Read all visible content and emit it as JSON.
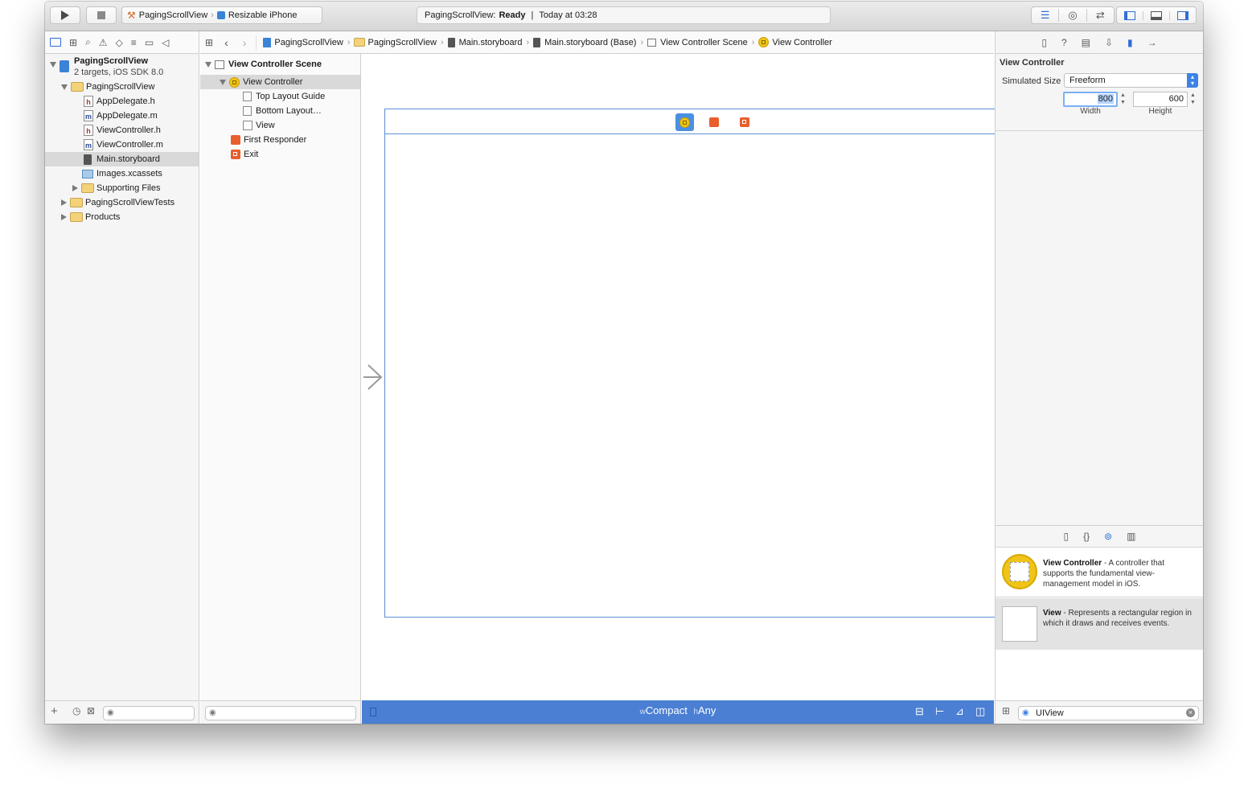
{
  "toolbar": {
    "scheme_name": "PagingScrollView",
    "destination": "Resizable iPhone",
    "activity_project": "PagingScrollView:",
    "activity_status": "Ready",
    "activity_separator": "|",
    "activity_time": "Today at 03:28"
  },
  "breadcrumb": {
    "items": [
      "PagingScrollView",
      "PagingScrollView",
      "Main.storyboard",
      "Main.storyboard (Base)",
      "View Controller Scene",
      "View Controller"
    ]
  },
  "navigator": {
    "project_name": "PagingScrollView",
    "project_subtitle": "2 targets, iOS SDK 8.0",
    "group_name": "PagingScrollView",
    "files": [
      {
        "name": "AppDelegate.h",
        "badge": "h"
      },
      {
        "name": "AppDelegate.m",
        "badge": "m"
      },
      {
        "name": "ViewController.h",
        "badge": "h"
      },
      {
        "name": "ViewController.m",
        "badge": "m"
      },
      {
        "name": "Main.storyboard",
        "badge": ""
      },
      {
        "name": "Images.xcassets",
        "badge": ""
      }
    ],
    "supporting_files": "Supporting Files",
    "tests_group": "PagingScrollViewTests",
    "products_group": "Products"
  },
  "outline": {
    "scene_title": "View Controller Scene",
    "view_controller": "View Controller",
    "top_layout_guide": "Top Layout Guide",
    "bottom_layout": "Bottom Layout…",
    "view": "View",
    "first_responder": "First Responder",
    "exit": "Exit"
  },
  "canvas": {
    "size_class_w_prefix": "w",
    "size_class_w": "Compact",
    "size_class_h_prefix": "h",
    "size_class_h": "Any",
    "accent": "#4a7fd4"
  },
  "inspector": {
    "section_title": "View Controller",
    "simulated_size_label": "Simulated Size",
    "simulated_size_value": "Freeform",
    "width_value": "800",
    "width_label": "Width",
    "height_value": "600",
    "height_label": "Height"
  },
  "library": {
    "items": [
      {
        "title": "View Controller",
        "desc": " - A controller that supports the fundamental view-management model in iOS."
      },
      {
        "title": "View",
        "desc": " - Represents a rectangular region in which it draws and receives events."
      }
    ],
    "search_value": "UIView"
  }
}
